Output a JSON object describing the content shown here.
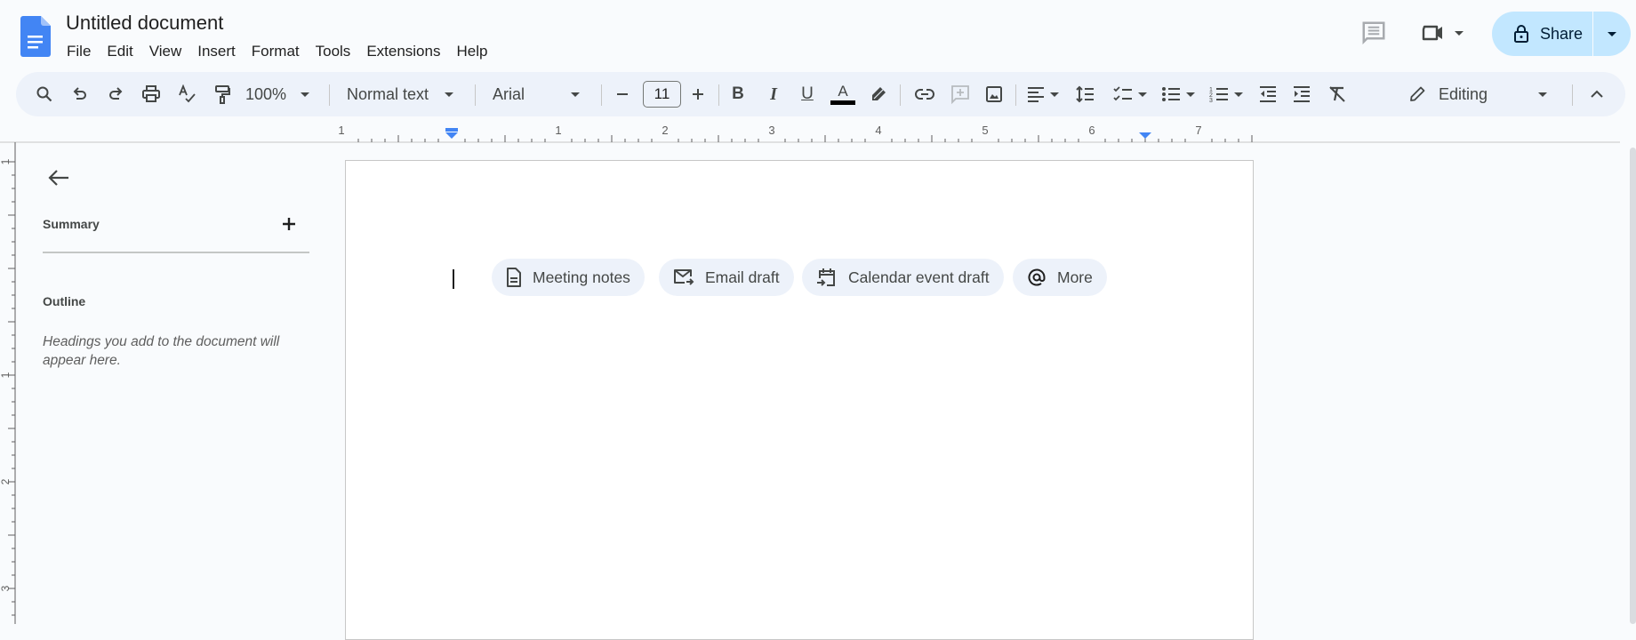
{
  "app": {
    "doc_title": "Untitled document",
    "menu": [
      "File",
      "Edit",
      "View",
      "Insert",
      "Format",
      "Tools",
      "Extensions",
      "Help"
    ],
    "share_label": "Share",
    "accent": "#0b57d0",
    "logo_color": "#4285f4"
  },
  "toolbar": {
    "zoom": "100%",
    "style": "Normal text",
    "font": "Arial",
    "font_size": "11",
    "mode": "Editing",
    "icons": [
      "search-icon",
      "undo-icon",
      "redo-icon",
      "print-icon",
      "spellcheck-icon",
      "paint-format-icon",
      "bold-icon",
      "italic-icon",
      "underline-icon",
      "text-color-icon",
      "highlight-icon",
      "link-icon",
      "add-comment-icon",
      "insert-image-icon",
      "align-icon",
      "line-spacing-icon",
      "checklist-icon",
      "bulleted-list-icon",
      "numbered-list-icon",
      "decrease-indent-icon",
      "increase-indent-icon",
      "clear-formatting-icon",
      "pencil-icon",
      "collapse-icon"
    ]
  },
  "ruler": {
    "labels": [
      "1",
      "1",
      "2",
      "3",
      "4",
      "5",
      "6",
      "7"
    ],
    "vertical_labels": [
      "1",
      "1",
      "2",
      "3"
    ]
  },
  "sidebar": {
    "summary_label": "Summary",
    "outline_label": "Outline",
    "outline_hint": "Headings you add to the document will appear here."
  },
  "document": {
    "chips": [
      {
        "label": "Meeting notes",
        "icon": "document-icon"
      },
      {
        "label": "Email draft",
        "icon": "email-icon"
      },
      {
        "label": "Calendar event draft",
        "icon": "calendar-icon"
      },
      {
        "label": "More",
        "icon": "at-sign-icon"
      }
    ]
  }
}
